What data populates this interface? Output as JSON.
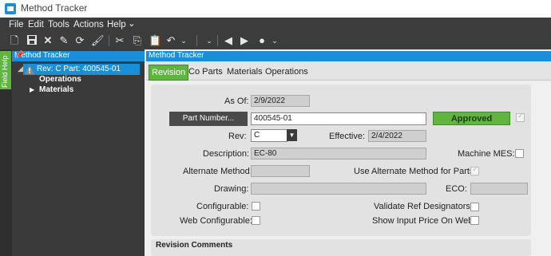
{
  "window": {
    "title": "Method Tracker"
  },
  "menu": [
    "File",
    "Edit",
    "Tools",
    "Actions",
    "Help"
  ],
  "field_help": {
    "label": "Field Help"
  },
  "tree_panel": {
    "title": "Method Tracker",
    "root": "Rev: C Part: 400545-01",
    "children": [
      "Operations",
      "Materials"
    ]
  },
  "main_panel": {
    "title": "Method Tracker",
    "tabs": [
      "Revision",
      "Co Parts",
      "Materials",
      "Operations"
    ],
    "active_tab": "Revision"
  },
  "form": {
    "as_of_label": "As Of:",
    "as_of_value": "2/9/2022",
    "part_number_button": "Part Number...",
    "part_number_value": "400545-01",
    "status": "Approved",
    "rev_label": "Rev:",
    "rev_value": "C",
    "effective_label": "Effective:",
    "effective_value": "2/4/2022",
    "description_label": "Description:",
    "description_value": "EC-80",
    "machine_mes_label": "Machine MES:",
    "alternate_method_label": "Alternate Method:",
    "use_alt_method_label": "Use Alternate Method for Parts:",
    "drawing_label": "Drawing:",
    "eco_label": "ECO:",
    "configurable_label": "Configurable:",
    "validate_ref_label": "Validate Ref Designators:",
    "web_configurable_label": "Web Configurable:",
    "show_input_price_label": "Show Input Price On Web:",
    "revision_comments_label": "Revision Comments"
  },
  "colors": {
    "accent_blue": "#1a8fd9",
    "accent_green": "#5fb53f",
    "dark_bar": "#3c3c3c"
  }
}
